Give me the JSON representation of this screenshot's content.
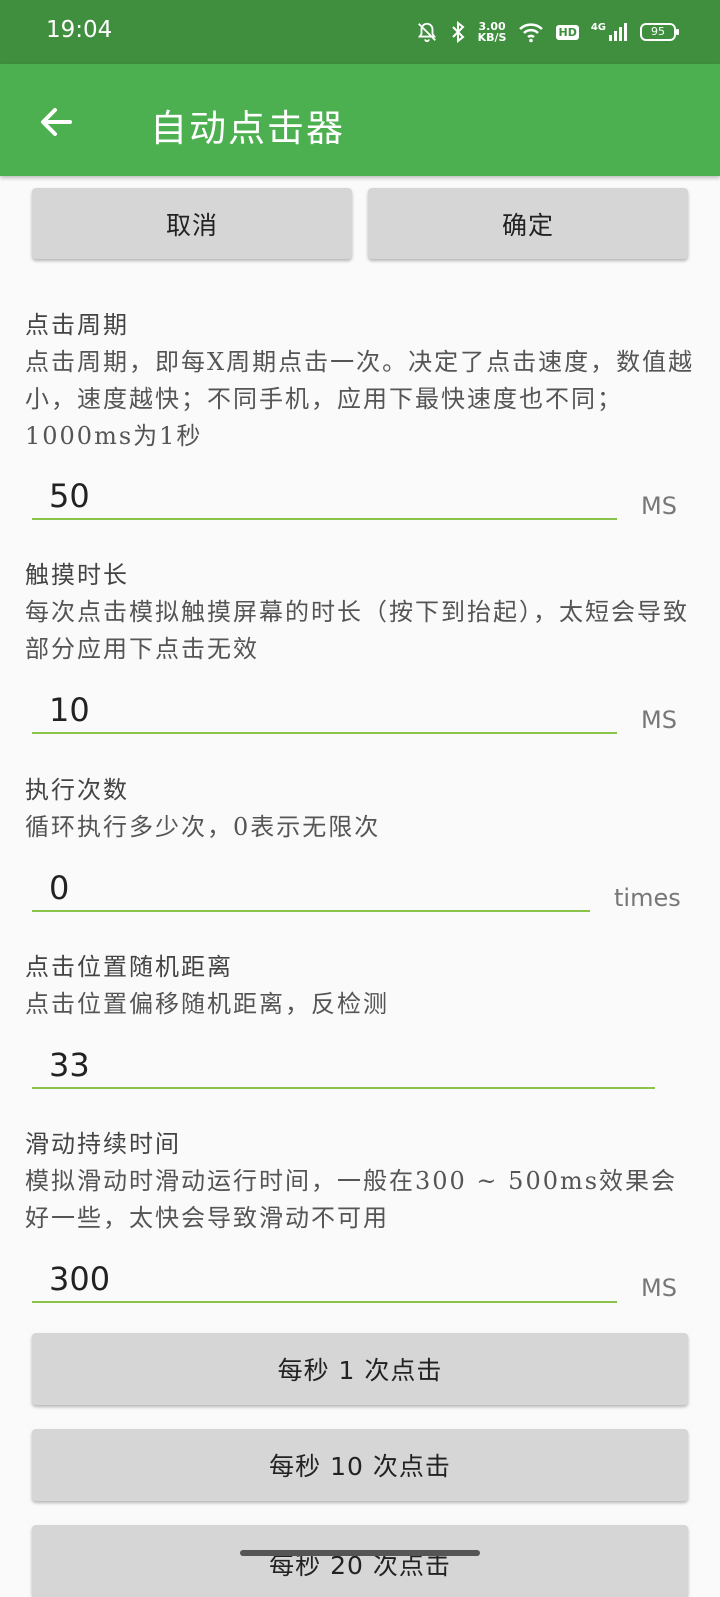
{
  "status": {
    "time": "19:04",
    "speed_value": "3.00",
    "speed_unit": "KB/S",
    "hd": "HD",
    "network": "4G",
    "battery": "95"
  },
  "appbar": {
    "title": "自动点击器"
  },
  "actions": {
    "cancel_label": "取消",
    "confirm_label": "确定"
  },
  "settings": [
    {
      "title": "点击周期",
      "desc": "点击周期，即每X周期点击一次。决定了点击速度，数值越小，速度越快；不同手机，应用下最快速度也不同；1000ms为1秒",
      "value": "50",
      "unit": "MS"
    },
    {
      "title": "触摸时长",
      "desc": "每次点击模拟触摸屏幕的时长（按下到抬起），太短会导致部分应用下点击无效",
      "value": "10",
      "unit": "MS"
    },
    {
      "title": "执行次数",
      "desc": "循环执行多少次，0表示无限次",
      "value": "0",
      "unit": "times"
    },
    {
      "title": "点击位置随机距离",
      "desc": "点击位置偏移随机距离，反检测",
      "value": "33",
      "unit": ""
    },
    {
      "title": "滑动持续时间",
      "desc": "模拟滑动时滑动运行时间，一般在300 ~ 500ms效果会好一些，太快会导致滑动不可用",
      "value": "300",
      "unit": "MS"
    }
  ],
  "presets": [
    {
      "label": "每秒 1 次点击"
    },
    {
      "label": "每秒 10 次点击"
    },
    {
      "label": "每秒 20 次点击"
    }
  ]
}
